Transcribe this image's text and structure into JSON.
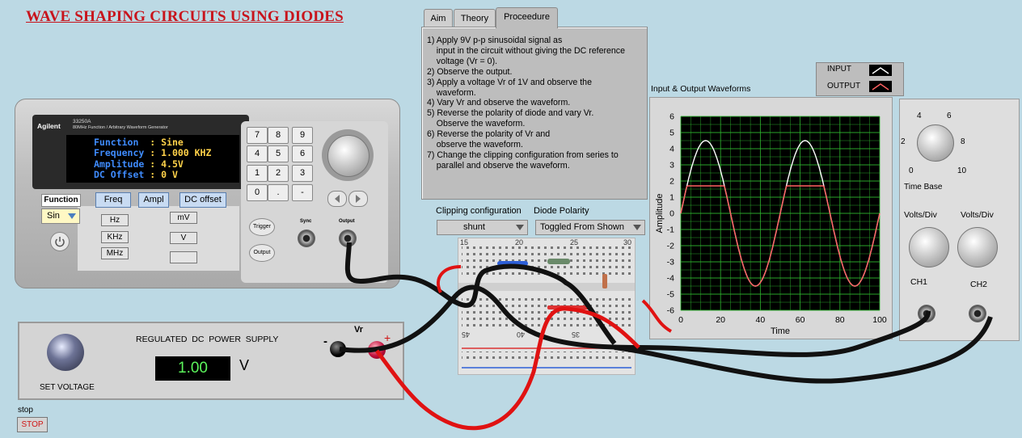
{
  "title": "WAVE SHAPING CIRCUITS USING DIODES",
  "tabs": [
    {
      "label": "Aim",
      "active": false
    },
    {
      "label": "Theory",
      "active": false
    },
    {
      "label": "Proceedure",
      "active": true
    }
  ],
  "procedure_lines": [
    "1) Apply 9V p-p sinusoidal signal as",
    "    input in the circuit without giving the DC reference",
    "    voltage (Vr = 0).",
    "2) Observe the output.",
    "3) Apply a voltage Vr of 1V and observe the",
    "    waveform.",
    "4) Vary Vr and observe the waveform.",
    "5) Reverse the polarity of diode and vary Vr.",
    "    Observe the waveform.",
    "6) Reverse the polarity of Vr and",
    "    observe the waveform.",
    "7) Change the clipping configuration from series to",
    "    parallel and observe the waveform."
  ],
  "function_generator": {
    "brand": "Agilent",
    "model": "33250A",
    "model_subtitle": "80MHz Function / Arbitrary Waveform Generator",
    "display": [
      {
        "label": "Function  ",
        "value": ": Sine"
      },
      {
        "label": "Frequency ",
        "value": ": 1.000 KHZ"
      },
      {
        "label": "Amplitude ",
        "value": ": 4.5V"
      },
      {
        "label": "DC Offset ",
        "value": ": 0 V"
      }
    ],
    "keypad": [
      "7",
      "8",
      "9",
      "4",
      "5",
      "6",
      "1",
      "2",
      "3",
      "0",
      ".",
      "-"
    ],
    "function_label": "Function",
    "function_value": "Sin",
    "freq_btn": "Freq",
    "ampl_btn": "Ampl",
    "dc_offset_btn": "DC offset",
    "unit_hz": "Hz",
    "unit_khz": "KHz",
    "unit_mhz": "MHz",
    "unit_mv": "mV",
    "unit_v": "V",
    "trigger": "Trigger",
    "output_btn": "Output",
    "sync_label": "Sync",
    "output_label": "Output"
  },
  "power_supply": {
    "title": "REGULATED  DC  POWER  SUPPLY",
    "set_voltage_label": "SET VOLTAGE",
    "value": "1.00",
    "unit": "V",
    "vr_label": "Vr",
    "minus": "-",
    "plus": "+"
  },
  "stop": {
    "label": "stop",
    "button": "STOP"
  },
  "clipping": {
    "label": "Clipping configuration",
    "value": "shunt"
  },
  "diode": {
    "label": "Diode Polarity",
    "value": "Toggled From Shown"
  },
  "breadboard": {
    "cols_top": [
      "15",
      "20",
      "25",
      "30"
    ],
    "cols_bottom": [
      "45",
      "40",
      "35"
    ]
  },
  "scope": {
    "caption": "Input & Output Waveforms",
    "ylabel": "Amplitude",
    "xlabel": "Time",
    "legend": [
      {
        "name": "INPUT",
        "color": "#ffffff"
      },
      {
        "name": "OUTPUT",
        "color": "#ff6060"
      }
    ],
    "grid_color": "#2fb52f",
    "bg_color": "#000000",
    "time_base_label": "Time Base",
    "time_base_ticks": [
      "2",
      "4",
      "6",
      "8",
      "10",
      "0"
    ],
    "volts_div_1": "Volts/Div",
    "volts_div_2": "Volts/Div",
    "ch1": "CH1",
    "ch2": "CH2"
  },
  "chart_data": {
    "type": "line",
    "title": "Input & Output Waveforms",
    "xlabel": "Time",
    "ylabel": "Amplitude",
    "xlim": [
      0,
      100
    ],
    "ylim": [
      -6,
      6
    ],
    "xticks": [
      0,
      20,
      40,
      60,
      80,
      100
    ],
    "yticks": [
      6,
      5,
      4,
      3,
      2,
      1,
      0,
      -1,
      -2,
      -3,
      -4,
      -5,
      -6
    ],
    "grid": true,
    "legend_position": "top-right",
    "series": [
      {
        "name": "INPUT",
        "color": "#ffffff",
        "amplitude": 4.5,
        "period": 50,
        "start": 0,
        "end": 100
      },
      {
        "name": "OUTPUT",
        "color": "#ff6060",
        "amplitude": 4.5,
        "clip_level": 1.7,
        "period": 50,
        "start": 0,
        "end": 100
      }
    ]
  }
}
